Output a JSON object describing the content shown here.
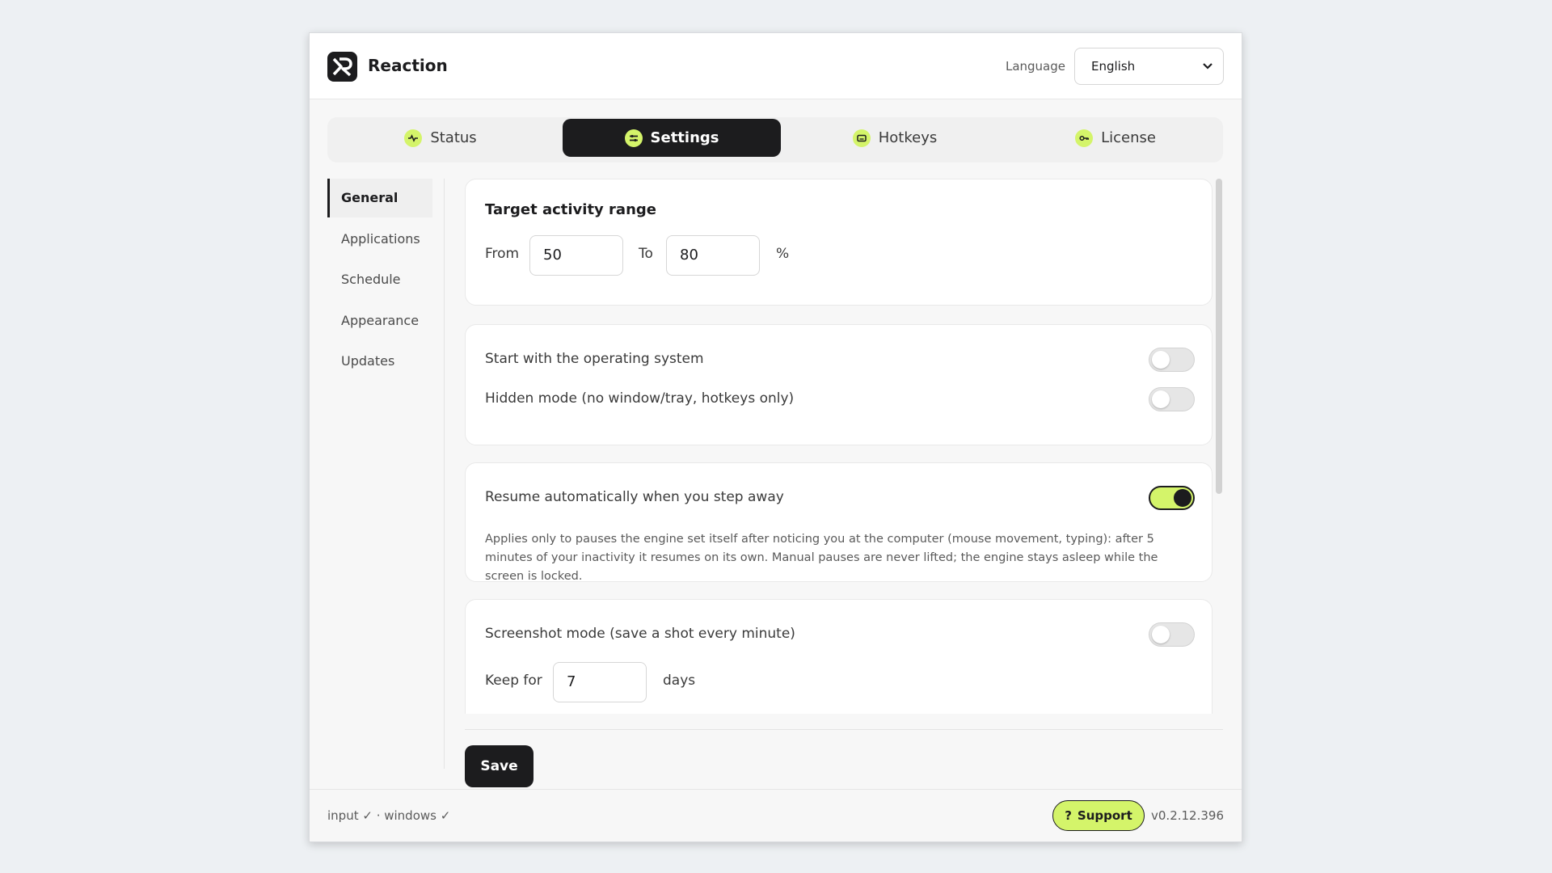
{
  "app": {
    "title": "Reaction"
  },
  "header": {
    "language_label": "Language",
    "language_value": "English"
  },
  "tabs": [
    {
      "label": "Status",
      "icon": "pulse-icon"
    },
    {
      "label": "Settings",
      "icon": "sliders-icon",
      "active": true
    },
    {
      "label": "Hotkeys",
      "icon": "keyboard-icon"
    },
    {
      "label": "License",
      "icon": "key-icon"
    }
  ],
  "sidebar": {
    "items": [
      {
        "label": "General",
        "active": true
      },
      {
        "label": "Applications"
      },
      {
        "label": "Schedule"
      },
      {
        "label": "Appearance"
      },
      {
        "label": "Updates"
      }
    ]
  },
  "activity": {
    "title": "Target activity range",
    "from_label": "From",
    "from_value": "50",
    "to_label": "To",
    "to_value": "80",
    "unit": "%"
  },
  "startup": {
    "start_os_label": "Start with the operating system",
    "start_os_on": false,
    "hidden_mode_label": "Hidden mode (no window/tray, hotkeys only)",
    "hidden_mode_on": false
  },
  "resume": {
    "label": "Resume automatically when you step away",
    "on": true,
    "description": "Applies only to pauses the engine set itself after noticing you at the computer (mouse movement, typing): after 5 minutes of your inactivity it resumes on its own. Manual pauses are never lifted; the engine stays asleep while the screen is locked."
  },
  "screenshot": {
    "label": "Screenshot mode (save a shot every minute)",
    "on": false,
    "keep_label": "Keep for",
    "keep_value": "7",
    "keep_unit": "days"
  },
  "actions": {
    "save_label": "Save"
  },
  "footer": {
    "status": "input ✓ · windows ✓",
    "support_label": "Support",
    "version": "v0.2.12.396"
  },
  "colors": {
    "accent": "#d4f46a",
    "dark": "#1c1c1e"
  }
}
